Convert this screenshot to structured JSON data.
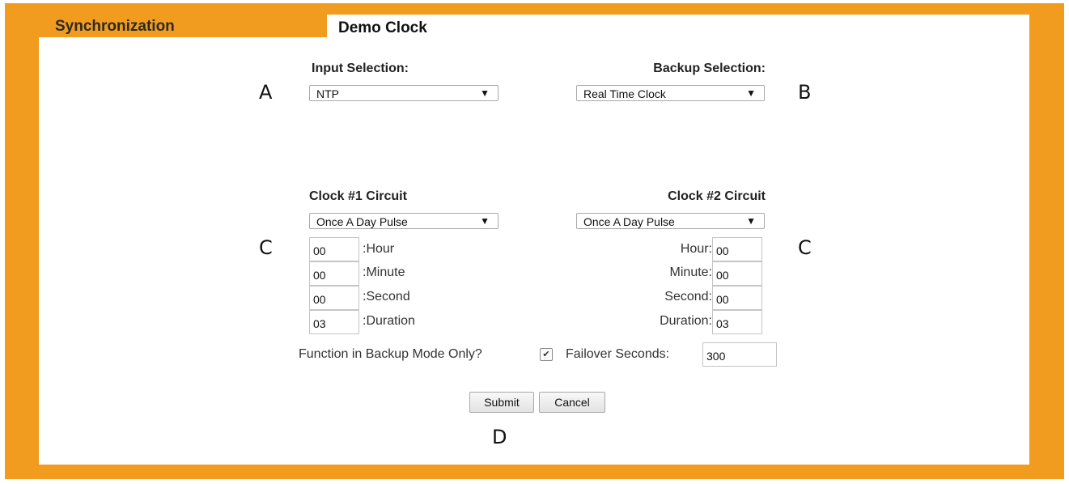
{
  "tabs": {
    "sync_label": "Synchronization",
    "demo_label": "Demo Clock"
  },
  "input_selection": {
    "heading": "Input Selection:",
    "value": "NTP",
    "annotation": "A"
  },
  "backup_selection": {
    "heading": "Backup Selection:",
    "value": "Real Time Clock",
    "annotation": "B"
  },
  "clock1": {
    "heading": "Clock #1 Circuit",
    "mode": "Once A Day Pulse",
    "annotation": "C",
    "fields": [
      {
        "label": ":Hour",
        "value": "00"
      },
      {
        "label": ":Minute",
        "value": "00"
      },
      {
        "label": ":Second",
        "value": "00"
      },
      {
        "label": ":Duration",
        "value": "03"
      }
    ]
  },
  "clock2": {
    "heading": "Clock #2 Circuit",
    "mode": "Once A Day Pulse",
    "annotation": "C",
    "fields": [
      {
        "label": "Hour:",
        "value": "00"
      },
      {
        "label": "Minute:",
        "value": "00"
      },
      {
        "label": "Second:",
        "value": "00"
      },
      {
        "label": "Duration:",
        "value": "03"
      }
    ]
  },
  "backup_mode": {
    "label": "Function in Backup Mode Only?",
    "checked": true,
    "failover_label": "Failover Seconds:",
    "failover_value": "300"
  },
  "actions": {
    "submit_label": "Submit",
    "cancel_label": "Cancel",
    "annotation": "D"
  },
  "colors": {
    "frame": "#f29c1f",
    "panel": "#ffffff"
  },
  "icons": {
    "dropdown": "dropdown-arrow-icon",
    "check": "checkmark-icon"
  }
}
